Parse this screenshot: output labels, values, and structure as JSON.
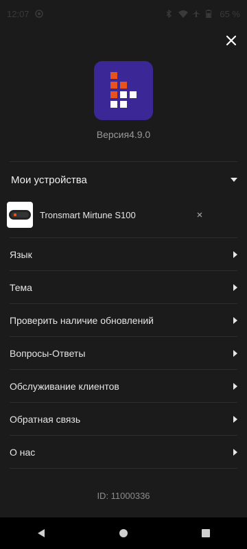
{
  "status": {
    "time": "12:07",
    "battery": "65 %"
  },
  "app": {
    "version": "Версия4.9.0"
  },
  "devices": {
    "title": "Мои устройства",
    "items": [
      {
        "name": "Tronsmart Mirtune S100"
      }
    ]
  },
  "menu": {
    "items": [
      {
        "label": "Язык"
      },
      {
        "label": "Тема"
      },
      {
        "label": "Проверить наличие обновлений"
      },
      {
        "label": "Вопросы-Ответы"
      },
      {
        "label": "Обслуживание клиентов"
      },
      {
        "label": "Обратная связь"
      },
      {
        "label": "О нас"
      }
    ]
  },
  "footer": {
    "id": "ID: 11000336"
  },
  "colors": {
    "logo_bg": "#3b2796",
    "logo_orange": "#e8521c",
    "logo_white": "#ffffff"
  },
  "icons": [
    "close-icon",
    "chevron-down-icon",
    "chevron-right-icon",
    "back-icon",
    "home-icon",
    "recents-icon"
  ]
}
